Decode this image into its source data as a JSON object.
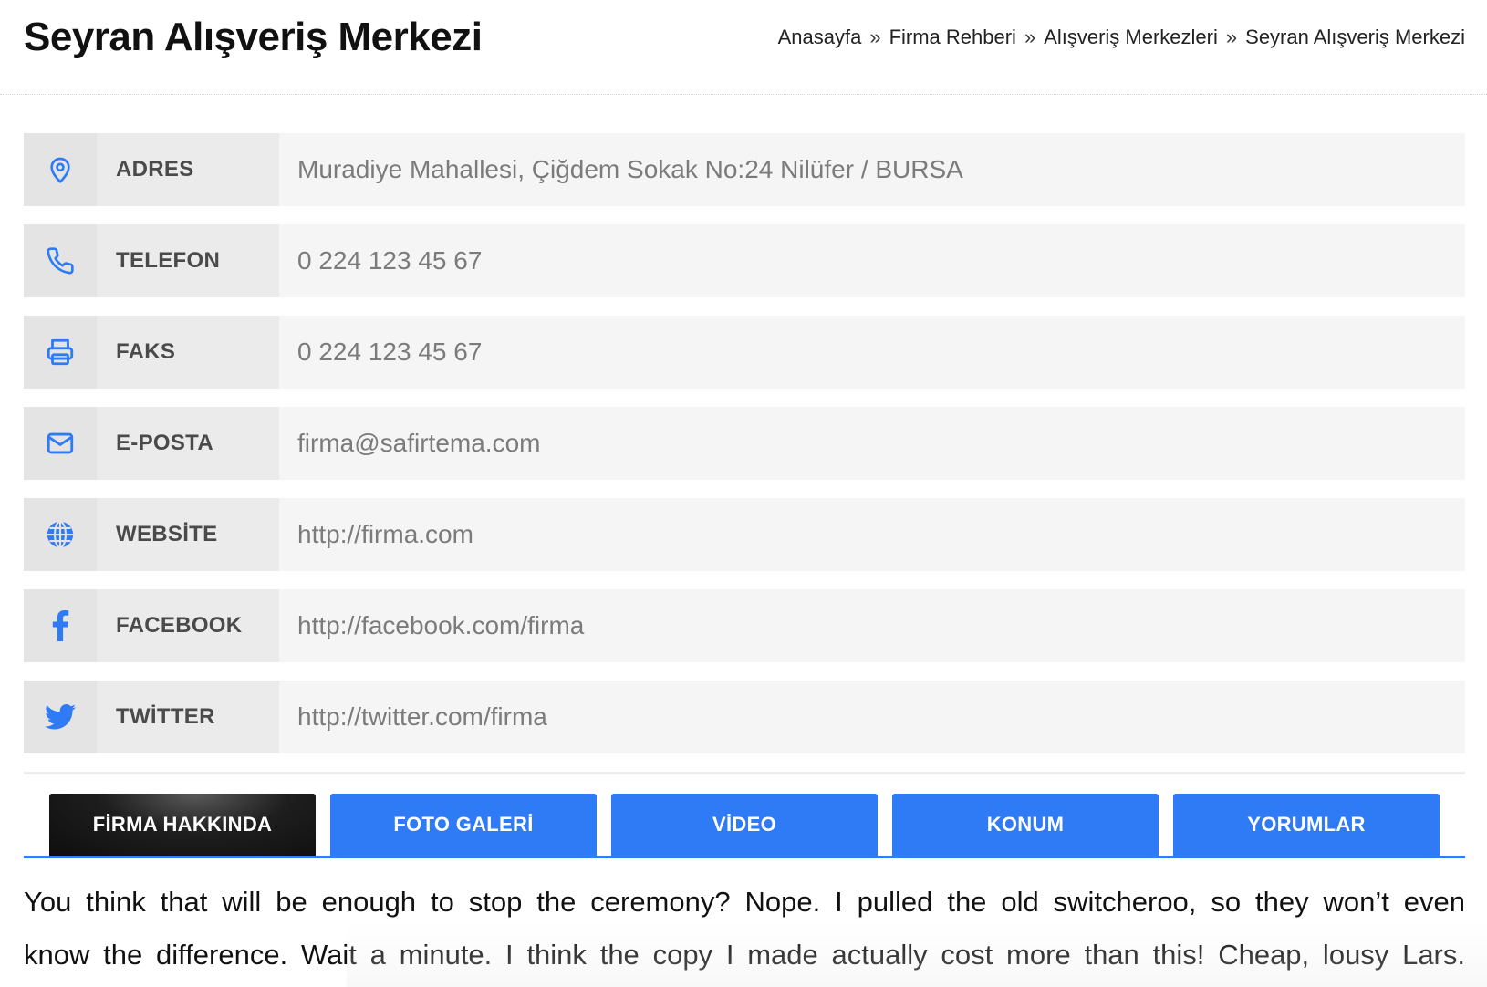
{
  "header": {
    "title": "Seyran Alışveriş Merkezi",
    "breadcrumb": [
      {
        "label": "Anasayfa"
      },
      {
        "label": "Firma Rehberi"
      },
      {
        "label": "Alışveriş Merkezleri"
      },
      {
        "label": "Seyran Alışveriş Merkezi"
      }
    ],
    "breadcrumb_separator": "»"
  },
  "info": {
    "address": {
      "icon": "location-pin-icon",
      "label": "ADRES",
      "value": "Muradiye Mahallesi, Çiğdem Sokak No:24 Nilüfer / BURSA"
    },
    "phone": {
      "icon": "phone-icon",
      "label": "TELEFON",
      "value": "0 224 123 45 67"
    },
    "fax": {
      "icon": "printer-icon",
      "label": "FAKS",
      "value": "0 224 123 45 67"
    },
    "email": {
      "icon": "envelope-icon",
      "label": "E-POSTA",
      "value": "firma@safirtema.com"
    },
    "website": {
      "icon": "globe-icon",
      "label": "WEBSİTE",
      "value": "http://firma.com"
    },
    "facebook": {
      "icon": "facebook-icon",
      "label": "FACEBOOK",
      "value": "http://facebook.com/firma"
    },
    "twitter": {
      "icon": "twitter-icon",
      "label": "TWİTTER",
      "value": "http://twitter.com/firma"
    }
  },
  "tabs": [
    {
      "label": "FİRMA HAKKINDA",
      "active": true
    },
    {
      "label": "FOTO GALERİ",
      "active": false
    },
    {
      "label": "VİDEO",
      "active": false
    },
    {
      "label": "KONUM",
      "active": false
    },
    {
      "label": "YORUMLAR",
      "active": false
    }
  ],
  "content": {
    "line1": "You think that will be enough to stop the ceremony? Nope. I pulled the old switcheroo, so they won’t even",
    "line2": "know the difference. Wait a minute. I think the copy I made actually cost more than this! Cheap, lousy Lars."
  },
  "colors": {
    "accent": "#2f7af5",
    "active_tab": "#111111",
    "icon": "#2f7af5",
    "row_bg": "#f5f5f5",
    "label_bg": "#ebebeb",
    "icon_bg": "#e4e4e4"
  }
}
